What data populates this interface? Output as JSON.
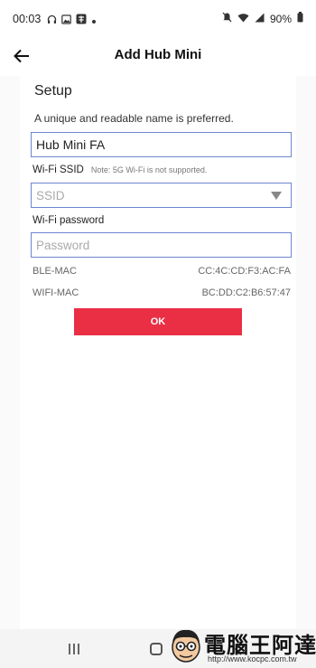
{
  "status_bar": {
    "time": "00:03",
    "battery": "90%",
    "left_icons": [
      "headset-icon",
      "image-icon",
      "app-icon",
      "dot-icon"
    ],
    "right_icons": [
      "mute-icon",
      "wifi-icon",
      "signal-icon",
      "battery-icon"
    ]
  },
  "app_bar": {
    "title": "Add Hub Mini",
    "back_icon": "back-arrow-icon"
  },
  "form": {
    "section_title": "Setup",
    "name_hint": "A unique and readable name is preferred.",
    "name_value": "Hub Mini FA",
    "ssid_label": "Wi-Fi SSID",
    "ssid_note": "Note: 5G Wi-Fi is not supported.",
    "ssid_placeholder": "SSID",
    "password_label": "Wi-Fi password",
    "password_placeholder": "Password",
    "ble_mac_label": "BLE-MAC",
    "ble_mac_value": "CC:4C:CD:F3:AC:FA",
    "wifi_mac_label": "WIFI-MAC",
    "wifi_mac_value": "BC:DD:C2:B6:57:47",
    "ok_label": "OK"
  },
  "colors": {
    "accent": "#ea2f44",
    "input_border": "#6e86d2"
  },
  "watermark": {
    "text": "電腦王阿達",
    "url": "http://www.kocpc.com.tw"
  }
}
